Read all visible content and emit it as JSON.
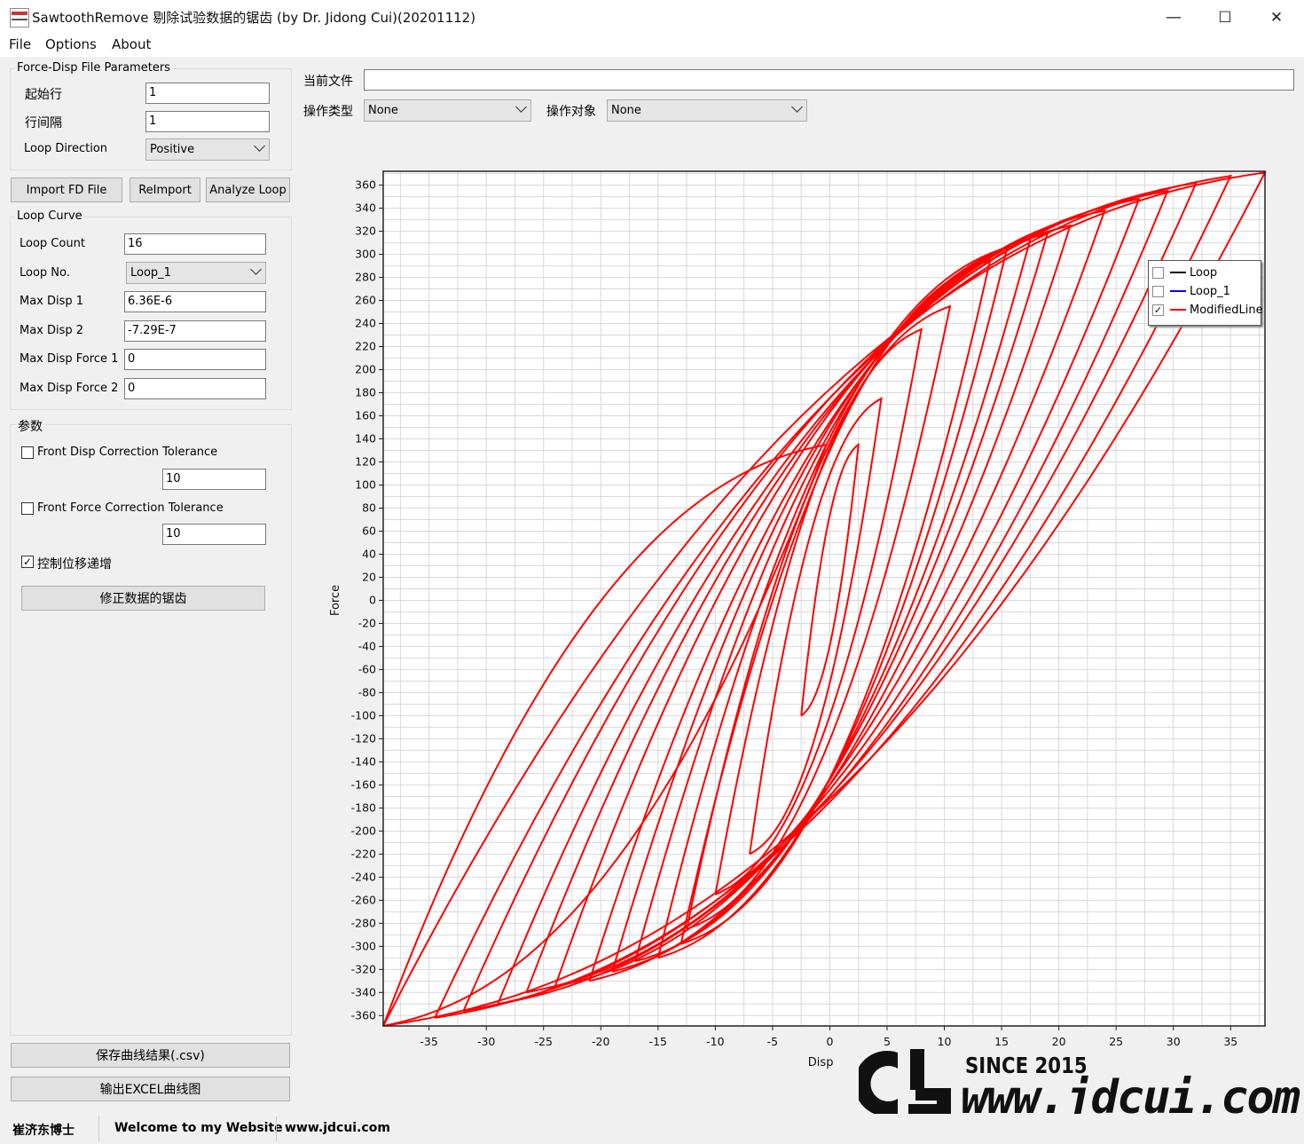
{
  "window": {
    "title": "SawtoothRemove 剔除试验数据的锯齿 (by Dr. Jidong Cui)(20201112)",
    "minimize": "—",
    "maximize": "☐",
    "close": "✕"
  },
  "menu": [
    "File",
    "Options",
    "About"
  ],
  "fd_params": {
    "group_title": "Force-Disp File Parameters",
    "start_row_label": "起始行",
    "start_row_value": "1",
    "row_interval_label": "行间隔",
    "row_interval_value": "1",
    "loop_direction_label": "Loop Direction",
    "loop_direction_value": "Positive"
  },
  "buttons": {
    "import": "Import FD File",
    "reimport": "ReImport",
    "analyze": "Analyze Loop",
    "fix": "修正数据的锯齿",
    "save_csv": "保存曲线结果(.csv)",
    "export_excel": "输出EXCEL曲线图"
  },
  "loop_curve": {
    "group_title": "Loop Curve",
    "count_label": "Loop Count",
    "count_value": "16",
    "no_label": "Loop No.",
    "no_value": "Loop_1",
    "max_disp1_label": "Max Disp 1",
    "max_disp1_value": "6.36E-6",
    "max_disp2_label": "Max Disp 2",
    "max_disp2_value": "-7.29E-7",
    "max_force1_label": "Max Disp Force 1",
    "max_force1_value": "0",
    "max_force2_label": "Max Disp Force 2",
    "max_force2_value": "0"
  },
  "params": {
    "group_title": "参数",
    "front_disp_label": "Front Disp Correction Tolerance",
    "front_disp_checked": false,
    "front_disp_value": "10",
    "front_force_label": "Front Force Correction Tolerance",
    "front_force_checked": false,
    "front_force_value": "10",
    "ctrl_disp_label": "控制位移递增",
    "ctrl_disp_checked": true
  },
  "top": {
    "current_file_label": "当前文件",
    "current_file_value": "",
    "op_type_label": "操作类型",
    "op_type_value": "None",
    "op_target_label": "操作对象",
    "op_target_value": "None"
  },
  "status": {
    "author": "崔济东博士",
    "welcome": "Welcome to my Website",
    "url": "www.jdcui.com"
  },
  "watermark": {
    "since": "SINCE 2015",
    "url": "www.jdcui.com"
  },
  "chart_data": {
    "type": "line",
    "xlabel": "Disp",
    "ylabel": "Force",
    "xlim": [
      -39,
      38
    ],
    "ylim": [
      -369,
      372
    ],
    "xticks": [
      -35,
      -30,
      -25,
      -20,
      -15,
      -10,
      -5,
      0,
      5,
      10,
      15,
      20,
      25,
      30,
      35
    ],
    "yticks": [
      360,
      340,
      320,
      300,
      280,
      260,
      240,
      220,
      200,
      180,
      160,
      140,
      120,
      100,
      80,
      60,
      40,
      20,
      0,
      -20,
      -40,
      -60,
      -80,
      -100,
      -120,
      -140,
      -160,
      -180,
      -200,
      -220,
      -240,
      -260,
      -280,
      -300,
      -320,
      -340,
      -360
    ],
    "grid": true,
    "legend_position": "top-right",
    "series": [
      {
        "name": "Loop",
        "color": "#000000",
        "visible": false,
        "x": [],
        "y": []
      },
      {
        "name": "Loop_1",
        "color": "#0000ff",
        "visible": false,
        "x": [],
        "y": []
      },
      {
        "name": "ModifiedLine",
        "color": "#ff0000",
        "visible": true,
        "loops": [
          {
            "max_disp": 2.5,
            "max_force": 135,
            "min_disp": -2.5,
            "min_force": -100
          },
          {
            "max_disp": 4.5,
            "max_force": 175,
            "min_disp": -7,
            "min_force": -220
          },
          {
            "max_disp": 8,
            "max_force": 235,
            "min_disp": -10,
            "min_force": -255
          },
          {
            "max_disp": 10.5,
            "max_force": 255,
            "min_disp": -12.5,
            "min_force": -285
          },
          {
            "max_disp": 14,
            "max_force": 295,
            "min_disp": -13,
            "min_force": -298
          },
          {
            "max_disp": 15.5,
            "max_force": 306,
            "min_disp": -15,
            "min_force": -310
          },
          {
            "max_disp": 17.5,
            "max_force": 313,
            "min_disp": -17,
            "min_force": -313
          },
          {
            "max_disp": 19,
            "max_force": 318,
            "min_disp": -19,
            "min_force": -322
          },
          {
            "max_disp": 21,
            "max_force": 325,
            "min_disp": -21,
            "min_force": -330
          },
          {
            "max_disp": 24,
            "max_force": 338,
            "min_disp": -24,
            "min_force": -335
          },
          {
            "max_disp": 27,
            "max_force": 348,
            "min_disp": -26.5,
            "min_force": -340
          },
          {
            "max_disp": 29.5,
            "max_force": 355,
            "min_disp": -29,
            "min_force": -350
          },
          {
            "max_disp": 32,
            "max_force": 362,
            "min_disp": -32,
            "min_force": -356
          },
          {
            "max_disp": 35,
            "max_force": 368,
            "min_disp": -34.5,
            "min_force": -362
          },
          {
            "max_disp": 38,
            "max_force": 371,
            "min_disp": -39,
            "min_force": -369
          },
          {
            "max_disp": -0.3,
            "max_force": 135,
            "min_disp": -39,
            "min_force": -369
          }
        ]
      }
    ]
  }
}
